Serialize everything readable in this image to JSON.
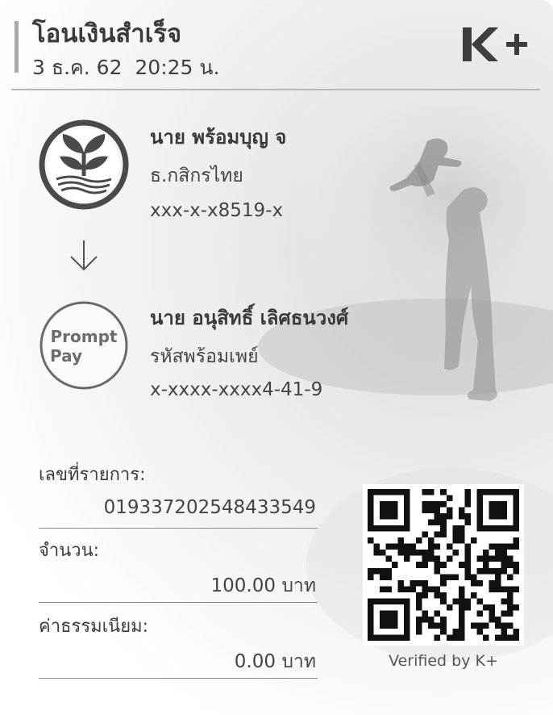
{
  "header": {
    "title": "โอนเงินสำเร็จ",
    "datetime": "3 ธ.ค. 62  20:25 น.",
    "logo": "K+"
  },
  "sender": {
    "name": "นาย พร้อมบุญ จ",
    "bank": "ธ.กสิกรไทย",
    "account": "xxx-x-x8519-x",
    "icon": "kbank-logo-icon"
  },
  "receiver": {
    "name": "นาย อนุสิทธิ์ เลิศธนวงศ์",
    "type": "รหัสพร้อมเพย์",
    "account": "x-xxxx-xxxx4-41-9",
    "icon_line1": "Prompt",
    "icon_line2": "Pay"
  },
  "details": {
    "ref_label": "เลขที่รายการ:",
    "ref_value": "019337202548433549",
    "amount_label": "จำนวน:",
    "amount_value": "100.00 บาท",
    "fee_label": "ค่าธรรมเนียม:",
    "fee_value": "0.00 บาท"
  },
  "qr": {
    "caption": "Verified by K+"
  },
  "colors": {
    "text": "#3a3a3a",
    "accent": "#a9a9a9",
    "divider": "#b7b7b7"
  }
}
